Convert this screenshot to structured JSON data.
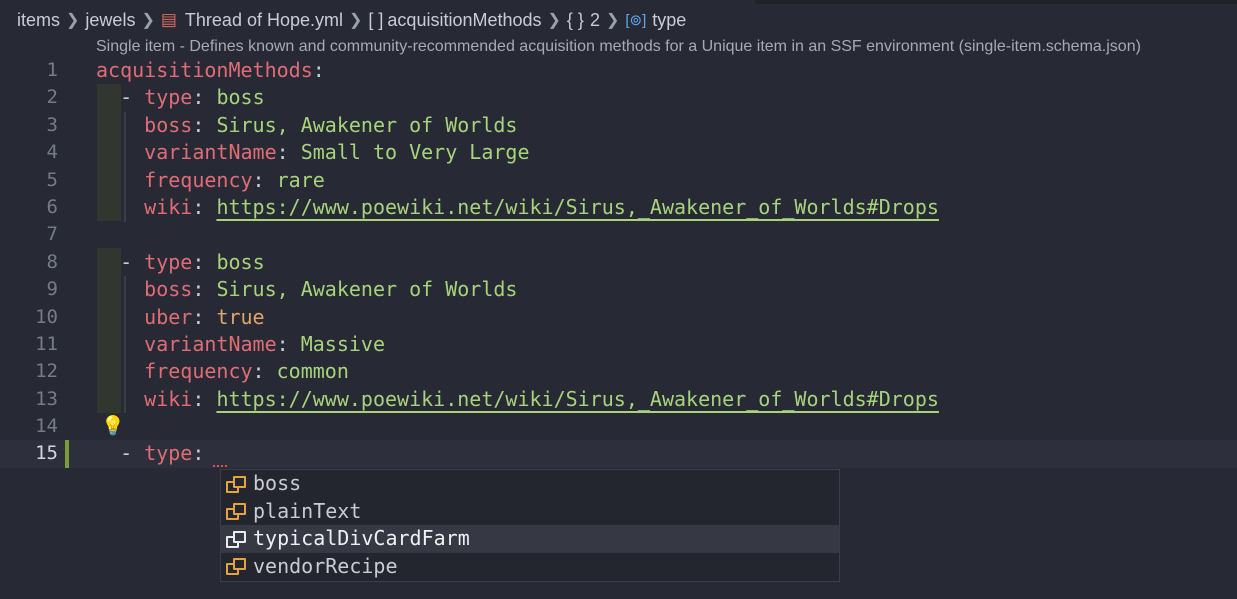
{
  "breadcrumb": {
    "items": [
      "items",
      "jewels",
      "Thread of Hope.yml",
      "[ ]",
      "acquisitionMethods",
      "{ }",
      "2",
      "type"
    ]
  },
  "schema_hint": "Single item - Defines known and community-recommended acquisition methods for a Unique item in an SSF environment (single-item.schema.json)",
  "lines": [
    {
      "n": "1",
      "key": "acquisitionMethods",
      "val": ""
    },
    {
      "n": "2",
      "dash": true,
      "key": "type",
      "val": "boss"
    },
    {
      "n": "3",
      "key": "boss",
      "val": "Sirus, Awakener of Worlds"
    },
    {
      "n": "4",
      "key": "variantName",
      "val": "Small to Very Large"
    },
    {
      "n": "5",
      "key": "frequency",
      "val": "rare"
    },
    {
      "n": "6",
      "key": "wiki",
      "val": "https://www.poewiki.net/wiki/Sirus,_Awakener_of_Worlds#Drops"
    },
    {
      "n": "7"
    },
    {
      "n": "8",
      "dash": true,
      "key": "type",
      "val": "boss"
    },
    {
      "n": "9",
      "key": "boss",
      "val": "Sirus, Awakener of Worlds"
    },
    {
      "n": "10",
      "key": "uber",
      "val": "true"
    },
    {
      "n": "11",
      "key": "variantName",
      "val": "Massive"
    },
    {
      "n": "12",
      "key": "frequency",
      "val": "common"
    },
    {
      "n": "13",
      "key": "wiki",
      "val": "https://www.poewiki.net/wiki/Sirus,_Awakener_of_Worlds#Drops"
    },
    {
      "n": "14"
    },
    {
      "n": "15",
      "dash": true,
      "key": "type",
      "val": ""
    }
  ],
  "suggestions": [
    "boss",
    "plainText",
    "typicalDivCardFarm",
    "vendorRecipe"
  ],
  "selected_suggestion": "typicalDivCardFarm",
  "colors": {
    "key": "#e06c75",
    "string": "#a7d37b",
    "accent": "#e6a23c"
  }
}
